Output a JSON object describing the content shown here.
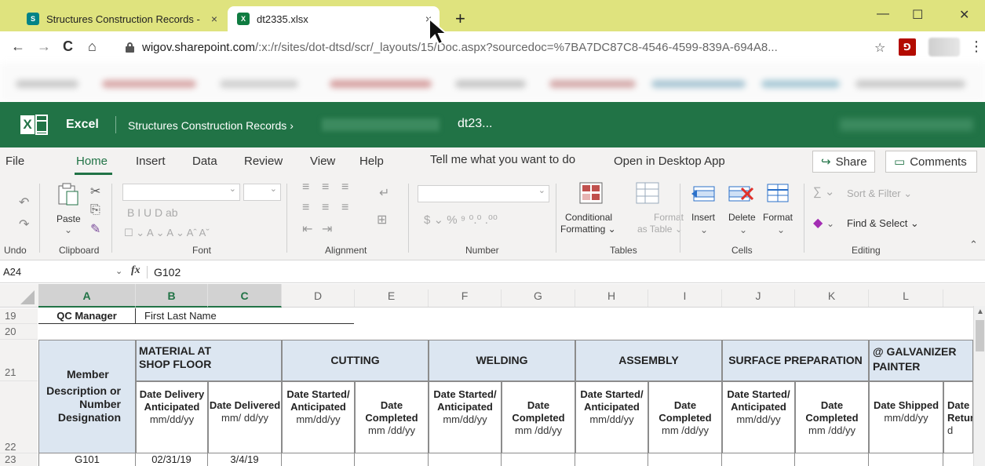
{
  "browser": {
    "tabs": [
      {
        "title": "Structures Construction Records -",
        "favicon": "S",
        "favicon_color": "#038387"
      },
      {
        "title": "dt2335.xlsx",
        "favicon": "X",
        "favicon_color": "#107c41"
      }
    ],
    "new_tab": "+",
    "close_glyph": "×",
    "window": {
      "minimize": "—",
      "maximize": "☐",
      "close": "✕"
    },
    "nav": {
      "back": "←",
      "forward": "→",
      "reload": "C",
      "home": "⌂"
    },
    "url_host": "wigov.sharepoint.com",
    "url_path": "/:x:/r/sites/dot-dtsd/scr/_layouts/15/Doc.aspx?sourcedoc=%7BA7DC87C8-4546-4599-839A-694A8...",
    "star": "☆",
    "pdf_ext": "⅁",
    "menu": "⋮"
  },
  "excel": {
    "app_name": "Excel",
    "breadcrumb": "Structures Construction Records",
    "breadcrumb_chevron": "›",
    "doc_name": "dt23...",
    "brand_color": "#217346"
  },
  "ribbon_tabs": {
    "file": "File",
    "home": "Home",
    "insert": "Insert",
    "data": "Data",
    "review": "Review",
    "view": "View",
    "help": "Help",
    "tell_me": "Tell me what you want to do",
    "open_desktop": "Open in Desktop App",
    "share": "Share",
    "comments": "Comments"
  },
  "ribbon": {
    "paste": "Paste",
    "groups": {
      "undo": "Undo",
      "clipboard": "Clipboard",
      "font": "Font",
      "alignment": "Alignment",
      "number": "Number",
      "tables": "Tables",
      "cells": "Cells",
      "editing": "Editing"
    },
    "conditional": "Conditional",
    "formatting": "Formatting ⌄",
    "format_label": "Format",
    "as_table": "as Table ⌄",
    "insert": "Insert",
    "delete": "Delete",
    "format": "Format",
    "sort_filter": "Sort & Filter ⌄",
    "find_select": "Find & Select ⌄",
    "sum_glyph": "∑ ⌄",
    "font_buttons": "B   I   U   D   ab",
    "font_colors": "☐ ⌄  A ⌄  A ⌄  Aˆ  Aˇ",
    "number_buttons": "$ ⌄  %  ⁹  ⁰.⁰  .⁰⁰"
  },
  "formula_bar": {
    "namebox": "A24",
    "fx": "fx",
    "content": "G102"
  },
  "grid": {
    "columns": [
      "A",
      "B",
      "C",
      "D",
      "E",
      "F",
      "G",
      "H",
      "I",
      "J",
      "K",
      "L"
    ],
    "rows": {
      "r19": "19",
      "r20": "20",
      "r21": "21",
      "r22": "22",
      "r23": "23"
    },
    "qc_manager_label": "QC Manager",
    "qc_manager_value": "First Last Name",
    "member_header": "Member",
    "member_desc": "Description or Number Designation",
    "groups": {
      "material": "MATERIAL AT SHOP FLOOR",
      "cutting": "CUTTING",
      "welding": "WELDING",
      "assembly": "ASSEMBLY",
      "surface": "SURFACE PREPARATION",
      "galvanizer": "@ GALVANIZER PAINTER"
    },
    "sub": {
      "b_bold": "Date Delivery Anticipated",
      "b_rest": "mm/dd/yy",
      "c_bold": "Date Delivered",
      "c_rest": "mm/ dd/yy",
      "started_bold": "Date Started/ Anticipated",
      "started_rest": "mm/dd/yy",
      "completed_bold": "Date Completed",
      "completed_rest": "mm /dd/yy",
      "shipped_bold": "Date Shipped",
      "shipped_rest": "mm/dd/yy",
      "returned_bold": "Date Retur",
      "returned_rest": "d"
    },
    "row23": {
      "a": "G101",
      "b": "02/31/19",
      "c": "3/4/19"
    }
  }
}
